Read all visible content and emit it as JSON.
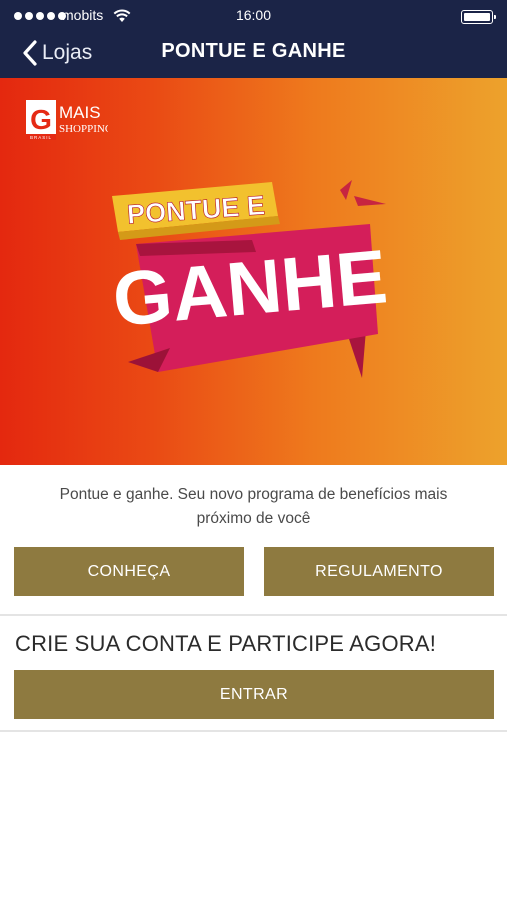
{
  "status_bar": {
    "carrier": "mobits",
    "time": "16:00"
  },
  "nav": {
    "back_label": "Lojas",
    "title": "PONTUE E GANHE"
  },
  "banner": {
    "brand_mark": "G",
    "brand_name_top": "MAIS",
    "brand_name_bottom": "SHOPPING",
    "brand_small": "BRASIL",
    "headline_top": "PONTUE E",
    "headline_main": "GANHE"
  },
  "intro": {
    "text": "Pontue e ganhe. Seu novo programa de benefícios mais próximo de você"
  },
  "buttons": {
    "conheca": "CONHEÇA",
    "regulamento": "REGULAMENTO",
    "entrar": "ENTRAR"
  },
  "signup": {
    "heading": "CRIE SUA CONTA E PARTICIPE AGORA!"
  },
  "colors": {
    "nav_background": "#1b2447",
    "button_gold": "#8e7a40",
    "banner_red": "#e4280f",
    "banner_orange": "#eda22c",
    "ribbon_pink": "#d41e5a",
    "ribbon_yellow": "#f2c12e"
  }
}
